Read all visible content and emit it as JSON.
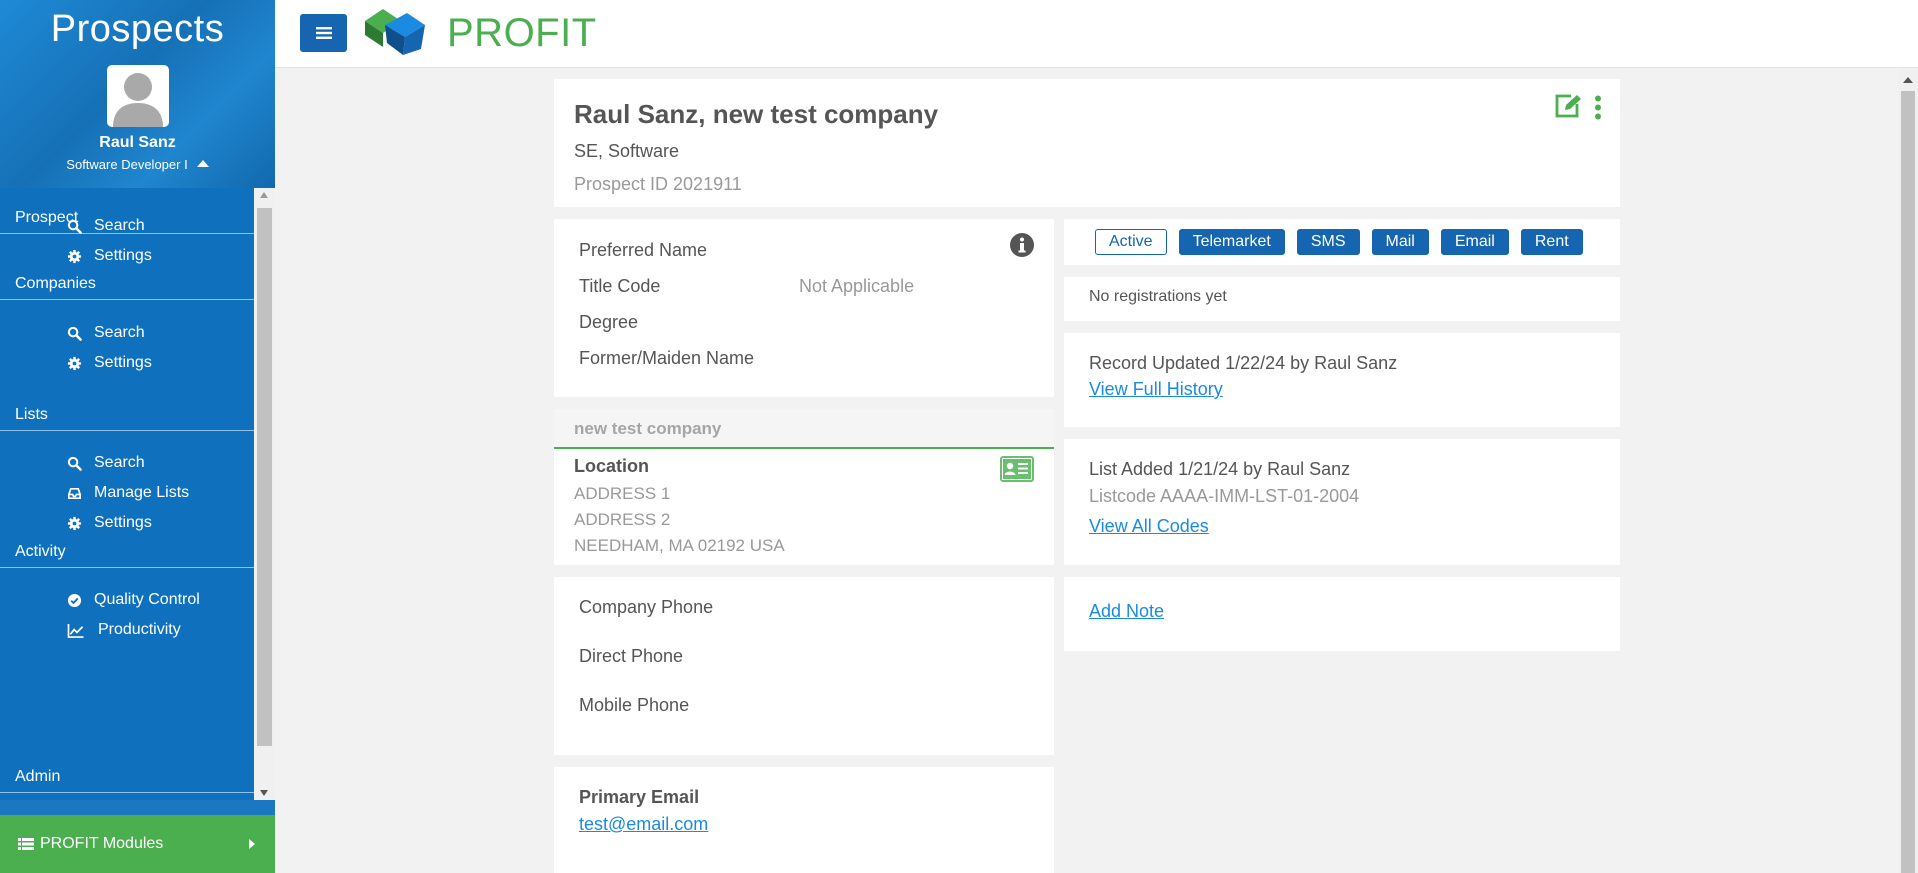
{
  "sidebar": {
    "app_title": "Prospects",
    "user_name": "Raul Sanz",
    "user_role": "Software Developer I",
    "sections": [
      {
        "label": "Prospect"
      },
      {
        "label": "Companies"
      },
      {
        "label": "Lists"
      },
      {
        "label": "Activity"
      },
      {
        "label": "Admin"
      }
    ],
    "items": [
      {
        "label": "Search",
        "icon": "search-icon"
      },
      {
        "label": "Settings",
        "icon": "gear-icon"
      },
      {
        "label": "Search",
        "icon": "search-icon"
      },
      {
        "label": "Settings",
        "icon": "gear-icon"
      },
      {
        "label": "Search",
        "icon": "search-icon"
      },
      {
        "label": "Manage Lists",
        "icon": "inbox-icon"
      },
      {
        "label": "Settings",
        "icon": "gear-icon"
      },
      {
        "label": "Quality Control",
        "icon": "check-circle-icon"
      },
      {
        "label": "Productivity",
        "icon": "line-chart-icon"
      }
    ],
    "modules_label": "PROFIT Modules"
  },
  "topbar": {
    "logo_text": "PROFIT"
  },
  "header": {
    "name": "Raul Sanz, new test company",
    "subtitle": "SE, Software",
    "prospect_id": "Prospect ID 2021911"
  },
  "name_info": {
    "preferred_name_label": "Preferred Name",
    "title_code_label": "Title Code",
    "title_code_value": "Not Applicable",
    "degree_label": "Degree",
    "maiden_name_label": "Former/Maiden Name"
  },
  "company": {
    "name": "new test company",
    "location_label": "Location",
    "address1": "ADDRESS 1",
    "address2": "ADDRESS 2",
    "city_line": "NEEDHAM, MA 02192 USA"
  },
  "phones": {
    "company_phone_label": "Company Phone",
    "direct_phone_label": "Direct Phone",
    "mobile_phone_label": "Mobile Phone"
  },
  "email": {
    "label": "Primary Email",
    "value": "test@email.com"
  },
  "badges": [
    {
      "label": "Active",
      "style": "outline"
    },
    {
      "label": "Telemarket",
      "style": "filled"
    },
    {
      "label": "SMS",
      "style": "filled"
    },
    {
      "label": "Mail",
      "style": "filled"
    },
    {
      "label": "Email",
      "style": "filled"
    },
    {
      "label": "Rent",
      "style": "filled"
    }
  ],
  "registrations": {
    "text": "No registrations yet"
  },
  "history": {
    "text": "Record Updated 1/22/24 by Raul Sanz",
    "link": "View Full History"
  },
  "list_info": {
    "text": "List Added 1/21/24 by Raul Sanz",
    "code": "Listcode AAAA-IMM-LST-01-2004",
    "link": "View All Codes"
  },
  "note": {
    "link": "Add Note"
  },
  "colors": {
    "sidebar_blue": "#1a78c2",
    "brand_green": "#4bae4f",
    "badge_blue": "#1565b0",
    "link_blue": "#1a8be0"
  }
}
